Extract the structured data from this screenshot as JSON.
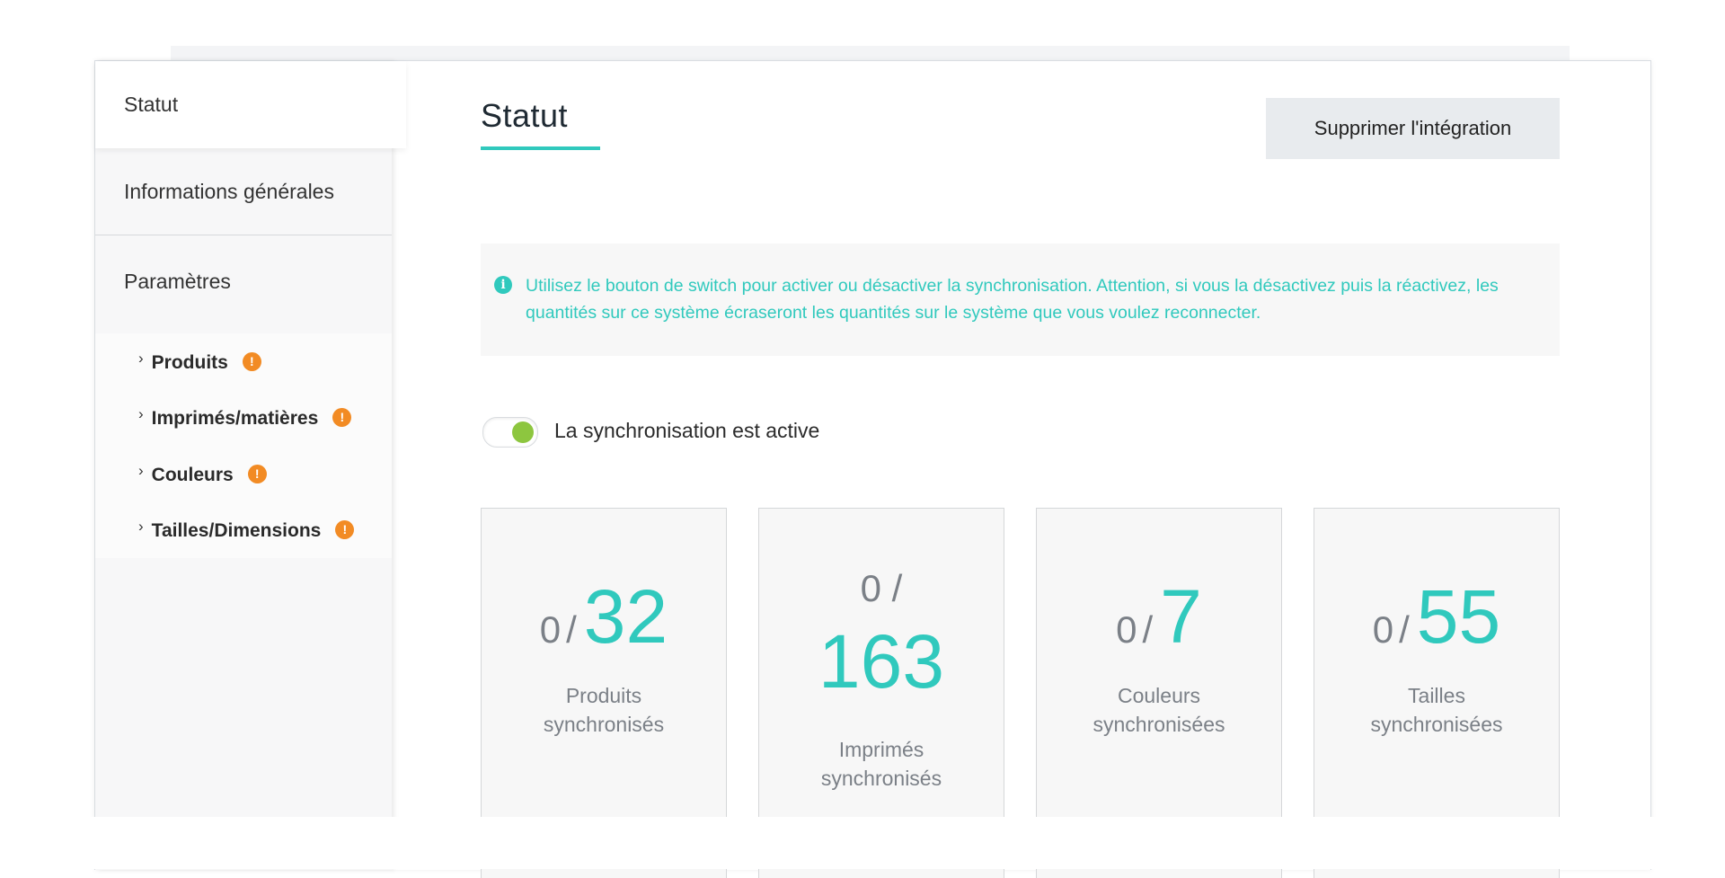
{
  "sidebar": {
    "items": [
      {
        "label": "Statut"
      },
      {
        "label": "Informations générales"
      },
      {
        "label": "Paramètres"
      }
    ],
    "sub_items": [
      {
        "label": "Produits",
        "warning": "!"
      },
      {
        "label": "Imprimés/matières",
        "warning": "!"
      },
      {
        "label": "Couleurs",
        "warning": "!"
      },
      {
        "label": "Tailles/Dimensions",
        "warning": "!"
      }
    ],
    "chevron": "›",
    "warning_icon": "exclamation-circle-icon"
  },
  "main": {
    "title": "Statut",
    "delete_button": "Supprimer l'intégration",
    "info": {
      "icon": "i",
      "text": "Utilisez le bouton de switch pour activer ou désactiver la synchronisation. Attention, si vous la désactivez puis la réactivez, les quantités sur ce système écraseront les quantités sur le système que vous voulez reconnecter."
    },
    "sync_toggle": {
      "enabled": true,
      "label": "La synchronisation est active"
    },
    "stats": [
      {
        "synced": "0",
        "separator": "/",
        "total": "32",
        "label_line1": "Produits",
        "label_line2": "synchronisés"
      },
      {
        "synced": "0",
        "separator": "/",
        "total": "163",
        "label_line1": "Imprimés",
        "label_line2": "synchronisés"
      },
      {
        "synced": "0",
        "separator": "/",
        "total": "7",
        "label_line1": "Couleurs",
        "label_line2": "synchronisées"
      },
      {
        "synced": "0",
        "separator": "/",
        "total": "55",
        "label_line1": "Tailles",
        "label_line2": "synchronisées"
      }
    ]
  },
  "colors": {
    "accent": "#30c9bd",
    "warning": "#f28b24",
    "toggle_on": "#8dc63f",
    "muted_text": "#7b8087",
    "button_bg": "#e8ebee"
  }
}
